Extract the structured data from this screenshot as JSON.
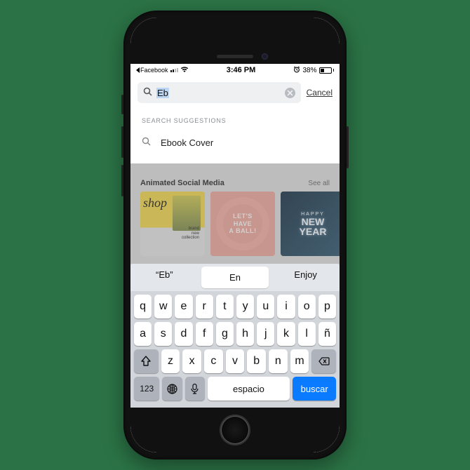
{
  "status": {
    "back_app": "Facebook",
    "time": "3:46 PM",
    "battery_pct": "38%"
  },
  "search": {
    "value": "Eb",
    "cancel": "Cancel"
  },
  "suggestions": {
    "heading": "SEARCH SUGGESTIONS",
    "items": [
      "Ebook Cover"
    ]
  },
  "bg_category": {
    "title": "Animated Social Media",
    "see_all": "See all",
    "cards": {
      "card1_text": "brand\nnew\ncollection",
      "card1_shop": "shop",
      "card2_text": "LET'S\nHAVE\nA BALL!",
      "card3_small": "HAPPY",
      "card3_line1": "NEW",
      "card3_line2": "YEAR"
    }
  },
  "keyboard": {
    "predictions": [
      "“Eb”",
      "En",
      "Enjoy"
    ],
    "row1": [
      "q",
      "w",
      "e",
      "r",
      "t",
      "y",
      "u",
      "i",
      "o",
      "p"
    ],
    "row2": [
      "a",
      "s",
      "d",
      "f",
      "g",
      "h",
      "j",
      "k",
      "l",
      "ñ"
    ],
    "row3": [
      "z",
      "x",
      "c",
      "v",
      "b",
      "n",
      "m"
    ],
    "num_label": "123",
    "space_label": "espacio",
    "action_label": "buscar"
  }
}
